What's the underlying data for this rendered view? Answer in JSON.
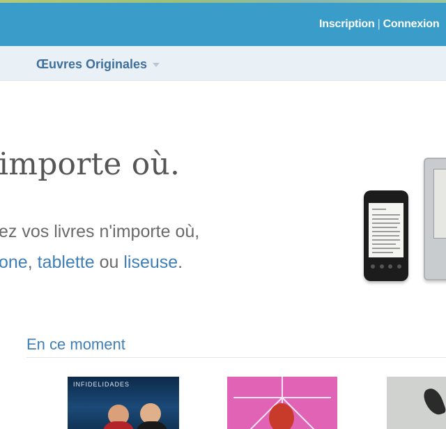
{
  "header": {
    "signup_label": "Inscription",
    "separator": "|",
    "login_label": "Connexion"
  },
  "nav": {
    "items": [
      {
        "label": "Œuvres Originales",
        "icon": "chevron-down-icon"
      }
    ]
  },
  "hero": {
    "title": "importe où.",
    "line1": "ez vos livres n'importe où,",
    "line2": {
      "link1": "one",
      "sep1": ", ",
      "link2": "tablette",
      "sep2": " ou ",
      "link3": "liseuse",
      "end": "."
    }
  },
  "section": {
    "title": "En ce moment",
    "cover1_text": "INFIDELIDADES"
  },
  "colors": {
    "topbar": "#3a9cc8",
    "nav_bg": "#eaf1f6",
    "link": "#3f7fb8",
    "nav_text": "#3f6f9c"
  }
}
